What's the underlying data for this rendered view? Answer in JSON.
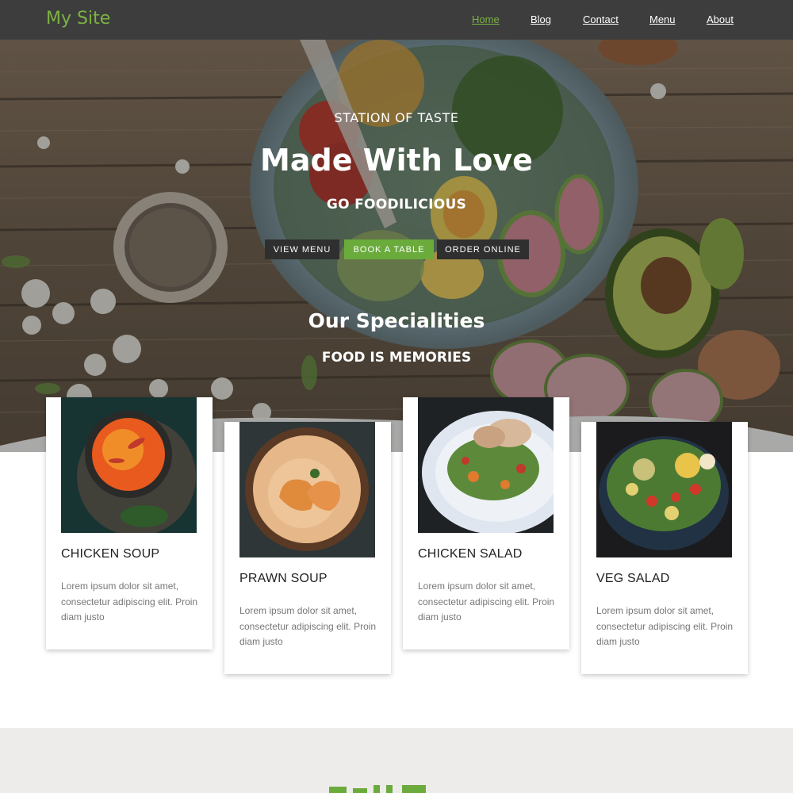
{
  "navbar": {
    "brand": "My Site",
    "links": [
      {
        "label": "Home",
        "active": true
      },
      {
        "label": "Blog",
        "active": false
      },
      {
        "label": "Contact",
        "active": false
      },
      {
        "label": "Menu",
        "active": false
      },
      {
        "label": "About",
        "active": false
      }
    ]
  },
  "hero": {
    "tagline": "STATION OF TASTE",
    "headline": "Made With Love",
    "subline": "GO FOODILICIOUS",
    "buttons": [
      {
        "label": "VIEW MENU",
        "style": "dark"
      },
      {
        "label": "BOOK A TABLE",
        "style": "green"
      },
      {
        "label": "ORDER ONLINE",
        "style": "dark"
      }
    ],
    "section_title": "Our Specialities",
    "section_subtitle": "FOOD IS MEMORIES"
  },
  "cards": [
    {
      "title": "CHICKEN SOUP",
      "desc": "Lorem ipsum dolor sit amet, consectetur adipiscing elit. Proin diam justo",
      "image": "soup-bowl-image"
    },
    {
      "title": "PRAWN SOUP",
      "desc": "Lorem ipsum dolor sit amet, consectetur adipiscing elit. Proin diam justo",
      "image": "prawn-bowl-image"
    },
    {
      "title": "CHICKEN SALAD",
      "desc": "Lorem ipsum dolor sit amet, consectetur adipiscing elit. Proin diam justo",
      "image": "salad-plate-image"
    },
    {
      "title": "VEG SALAD",
      "desc": "Lorem ipsum dolor sit amet, consectetur adipiscing elit. Proin diam justo",
      "image": "veg-bowl-image"
    }
  ],
  "colors": {
    "accent": "#7cb342",
    "navbar": "#3d3d3e",
    "button_dark": "#2f2f30",
    "button_green": "#6aab3c",
    "band": "#edecea"
  }
}
